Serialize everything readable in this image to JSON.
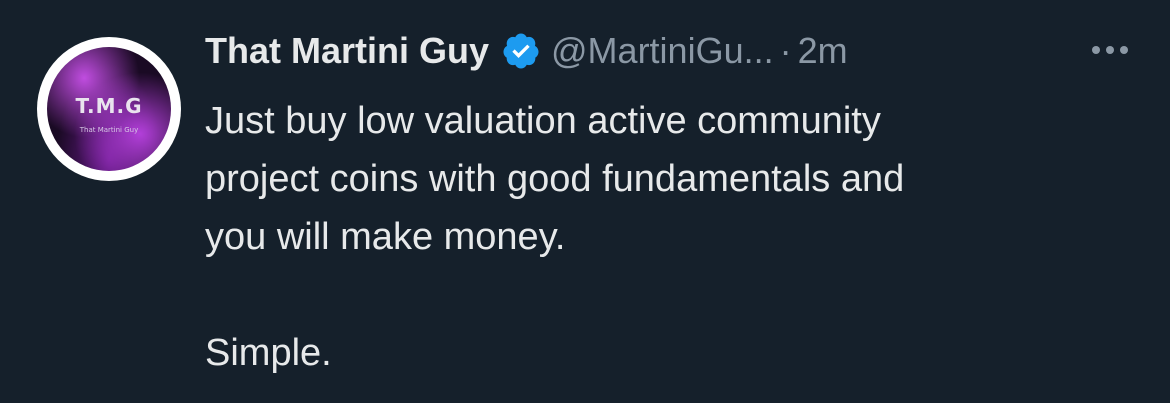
{
  "tweet": {
    "avatar": {
      "text": "T.M.G",
      "subtext": "That Martini Guy"
    },
    "author_name": "That Martini Guy",
    "verified": true,
    "handle": "@MartiniGu...",
    "separator": "·",
    "time": "2m",
    "more_icon": "more-horizontal-icon",
    "body_lines": [
      "Just buy low valuation active community",
      "project coins with good fundamentals and",
      "you will make money."
    ],
    "closing": "Simple."
  },
  "colors": {
    "background": "#15202b",
    "text": "#e7e9ea",
    "muted": "#8b98a5",
    "verified": "#1d9bf0"
  }
}
